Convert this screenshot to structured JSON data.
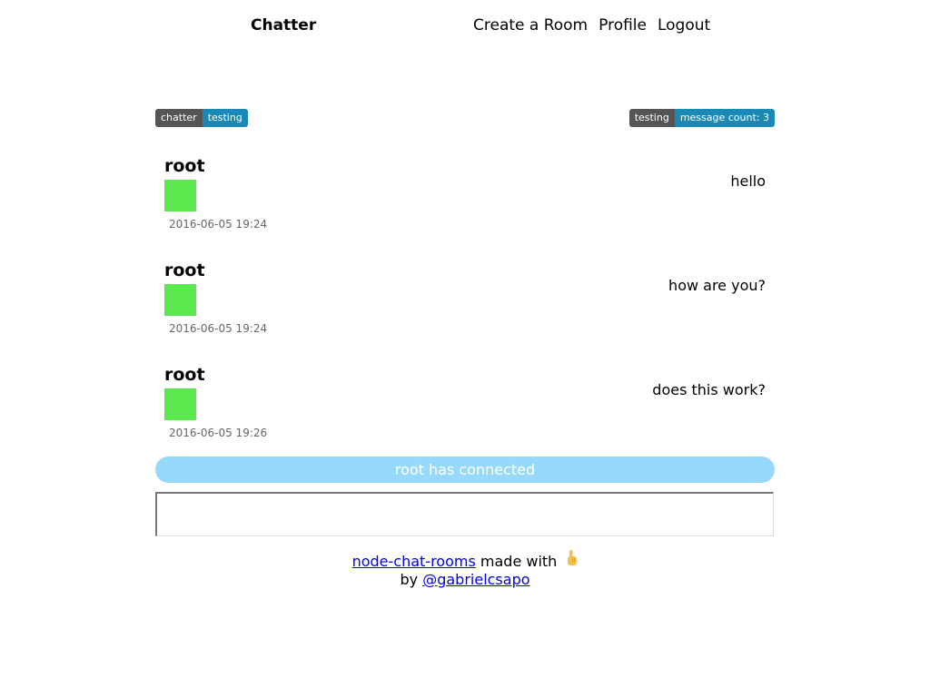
{
  "header": {
    "brand": "Chatter",
    "nav": [
      "Create a Room",
      "Profile",
      "Logout"
    ]
  },
  "badges": {
    "left": {
      "label": "chatter",
      "value": "testing"
    },
    "right": {
      "label": "testing",
      "value": "message count: 3"
    }
  },
  "messages": [
    {
      "user": "root",
      "text": "hello",
      "time": "2016-06-05 19:24"
    },
    {
      "user": "root",
      "text": "how are you?",
      "time": "2016-06-05 19:24"
    },
    {
      "user": "root",
      "text": "does this work?",
      "time": "2016-06-05 19:26"
    }
  ],
  "colors": {
    "avatar": "#5be84f",
    "notice": "#96d9fc",
    "badge_dark": "#555555",
    "badge_accent": "#1b89b6"
  },
  "notice": "root has connected",
  "input": {
    "placeholder": ""
  },
  "footer": {
    "project_link": "node-chat-rooms",
    "made_with": "made with",
    "icon": "pointing-finger-icon",
    "by": "by",
    "author_link": "@gabrielcsapo"
  }
}
